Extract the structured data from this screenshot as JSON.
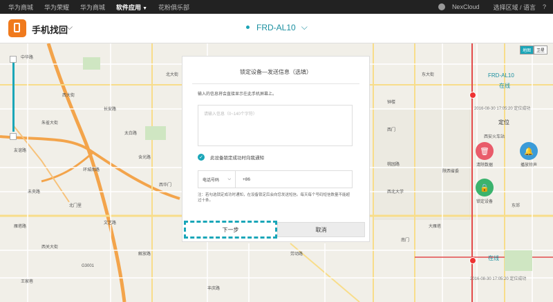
{
  "topnav": {
    "items": [
      {
        "label": "华为商城"
      },
      {
        "label": "华为荣耀"
      },
      {
        "label": "华为商城"
      },
      {
        "label": "软件应用",
        "active": true
      },
      {
        "label": "花粉俱乐部"
      }
    ],
    "user": "NexCloud",
    "user_menu": "选择区域 / 语言",
    "help": "?"
  },
  "header": {
    "app_title": "手机找回",
    "device_name": "FRD-AL10"
  },
  "map": {
    "type_toggle": [
      "地图",
      "卫星"
    ],
    "labels": [
      {
        "text": "中华路"
      },
      {
        "text": "北大街"
      },
      {
        "text": "东大街"
      },
      {
        "text": "西大街"
      },
      {
        "text": "钟楼"
      },
      {
        "text": "长安路"
      },
      {
        "text": "朱雀大街"
      },
      {
        "text": "太白路"
      },
      {
        "text": "友谊路"
      },
      {
        "text": "环城南路"
      },
      {
        "text": "含光路"
      },
      {
        "text": "未央路"
      },
      {
        "text": "西华门"
      },
      {
        "text": "北门里"
      },
      {
        "text": "雁塔路"
      },
      {
        "text": "文艺路"
      },
      {
        "text": "G3001"
      },
      {
        "text": "西关大街"
      },
      {
        "text": "解放路"
      },
      {
        "text": "王家巷"
      },
      {
        "text": "西门"
      },
      {
        "text": "桃园路"
      },
      {
        "text": "东郊"
      },
      {
        "text": "西北大学"
      },
      {
        "text": "大雁塔"
      },
      {
        "text": "陕西省委"
      },
      {
        "text": "西安火车站"
      },
      {
        "text": "南门"
      },
      {
        "text": "劳动路"
      },
      {
        "text": "丰庆路"
      }
    ],
    "status_top": {
      "device": "FRD-AL10",
      "state": "在线",
      "time": "2016-08-30 17:05:20 定位成功"
    },
    "status_bottom": {
      "state": "在线",
      "time": "2016-08-30 17:05:20 定位成功"
    },
    "locate_label": "定位",
    "actions": [
      {
        "label": "清除数据",
        "icon": "trash-icon",
        "color": "#e95b6a"
      },
      {
        "label": "播放铃声",
        "icon": "bell-icon",
        "color": "#3b9bd8"
      },
      {
        "label": "锁定设备",
        "icon": "lock-icon",
        "color": "#3bb36d"
      }
    ]
  },
  "modal": {
    "title": "锁定设备—发送信息（选填）",
    "hint": "输入的信息将会直接显示在此手机屏幕上。",
    "message_placeholder": "请输入信息（0~140个字符）",
    "checkbox_label": "此设备锁定成功时向我通知",
    "phone_type": "电话号码",
    "country_code": "+86",
    "note": "注：若勾选锁定成功时通知，在设备锁定后会向您发送短信。每天每个号码短信数量不能超过十条。",
    "next_button": "下一步",
    "cancel_button": "取消"
  }
}
